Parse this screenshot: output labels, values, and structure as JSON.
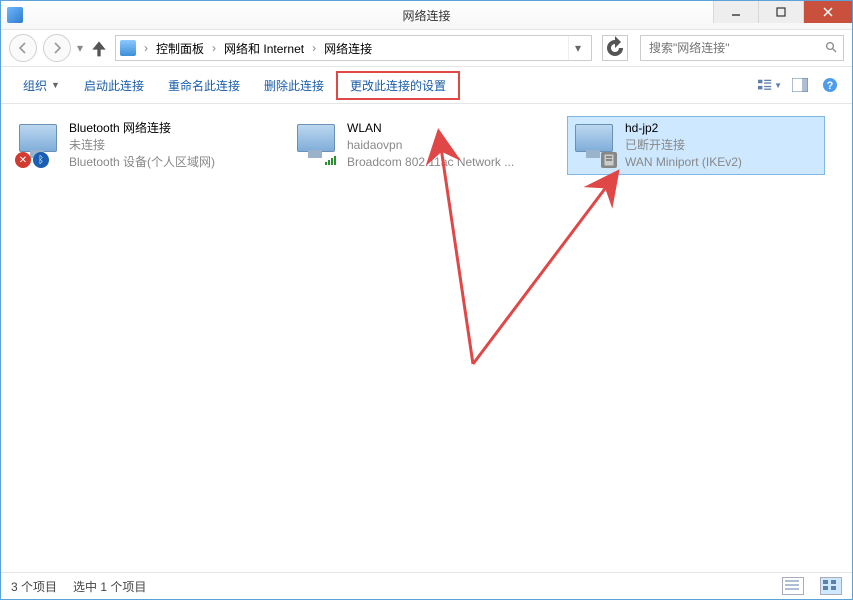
{
  "window": {
    "title": "网络连接"
  },
  "breadcrumb": {
    "seg1": "控制面板",
    "seg2": "网络和 Internet",
    "seg3": "网络连接"
  },
  "search": {
    "placeholder": "搜索\"网络连接\""
  },
  "toolbar": {
    "organize": "组织",
    "start": "启动此连接",
    "rename": "重命名此连接",
    "delete": "删除此连接",
    "change_settings": "更改此连接的设置"
  },
  "items": [
    {
      "name": "Bluetooth 网络连接",
      "status": "未连接",
      "device": "Bluetooth 设备(个人区域网)"
    },
    {
      "name": "WLAN",
      "status": "haidaovpn",
      "device": "Broadcom 802.11ac Network ..."
    },
    {
      "name": "hd-jp2",
      "status": "已断开连接",
      "device": "WAN Miniport (IKEv2)"
    }
  ],
  "statusbar": {
    "count": "3 个项目",
    "selected": "选中 1 个项目"
  }
}
